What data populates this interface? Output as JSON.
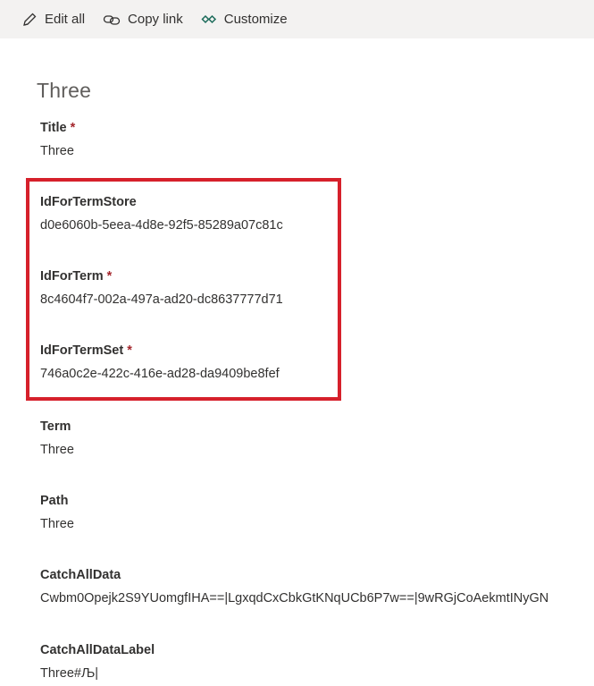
{
  "toolbar": {
    "edit_all": "Edit all",
    "copy_link": "Copy link",
    "customize": "Customize"
  },
  "item_title": "Three",
  "required_mark": "*",
  "fields": {
    "title": {
      "label": "Title",
      "value": "Three"
    },
    "id_for_term_store": {
      "label": "IdForTermStore",
      "value": "d0e6060b-5eea-4d8e-92f5-85289a07c81c"
    },
    "id_for_term": {
      "label": "IdForTerm",
      "value": "8c4604f7-002a-497a-ad20-dc8637777d71"
    },
    "id_for_term_set": {
      "label": "IdForTermSet",
      "value": "746a0c2e-422c-416e-ad28-da9409be8fef"
    },
    "term": {
      "label": "Term",
      "value": "Three"
    },
    "path": {
      "label": "Path",
      "value": "Three"
    },
    "catch_all_data": {
      "label": "CatchAllData",
      "value": "Cwbm0Opejk2S9YUomgfIHA==|LgxqdCxCbkGtKNqUCb6P7w==|9wRGjCoAekmtINyGN"
    },
    "catch_all_data_label": {
      "label": "CatchAllDataLabel",
      "value": "Three#Љ|"
    }
  },
  "colors": {
    "highlight": "#d6202b",
    "required": "#a4262c",
    "icon_accent": "#106ebe"
  }
}
